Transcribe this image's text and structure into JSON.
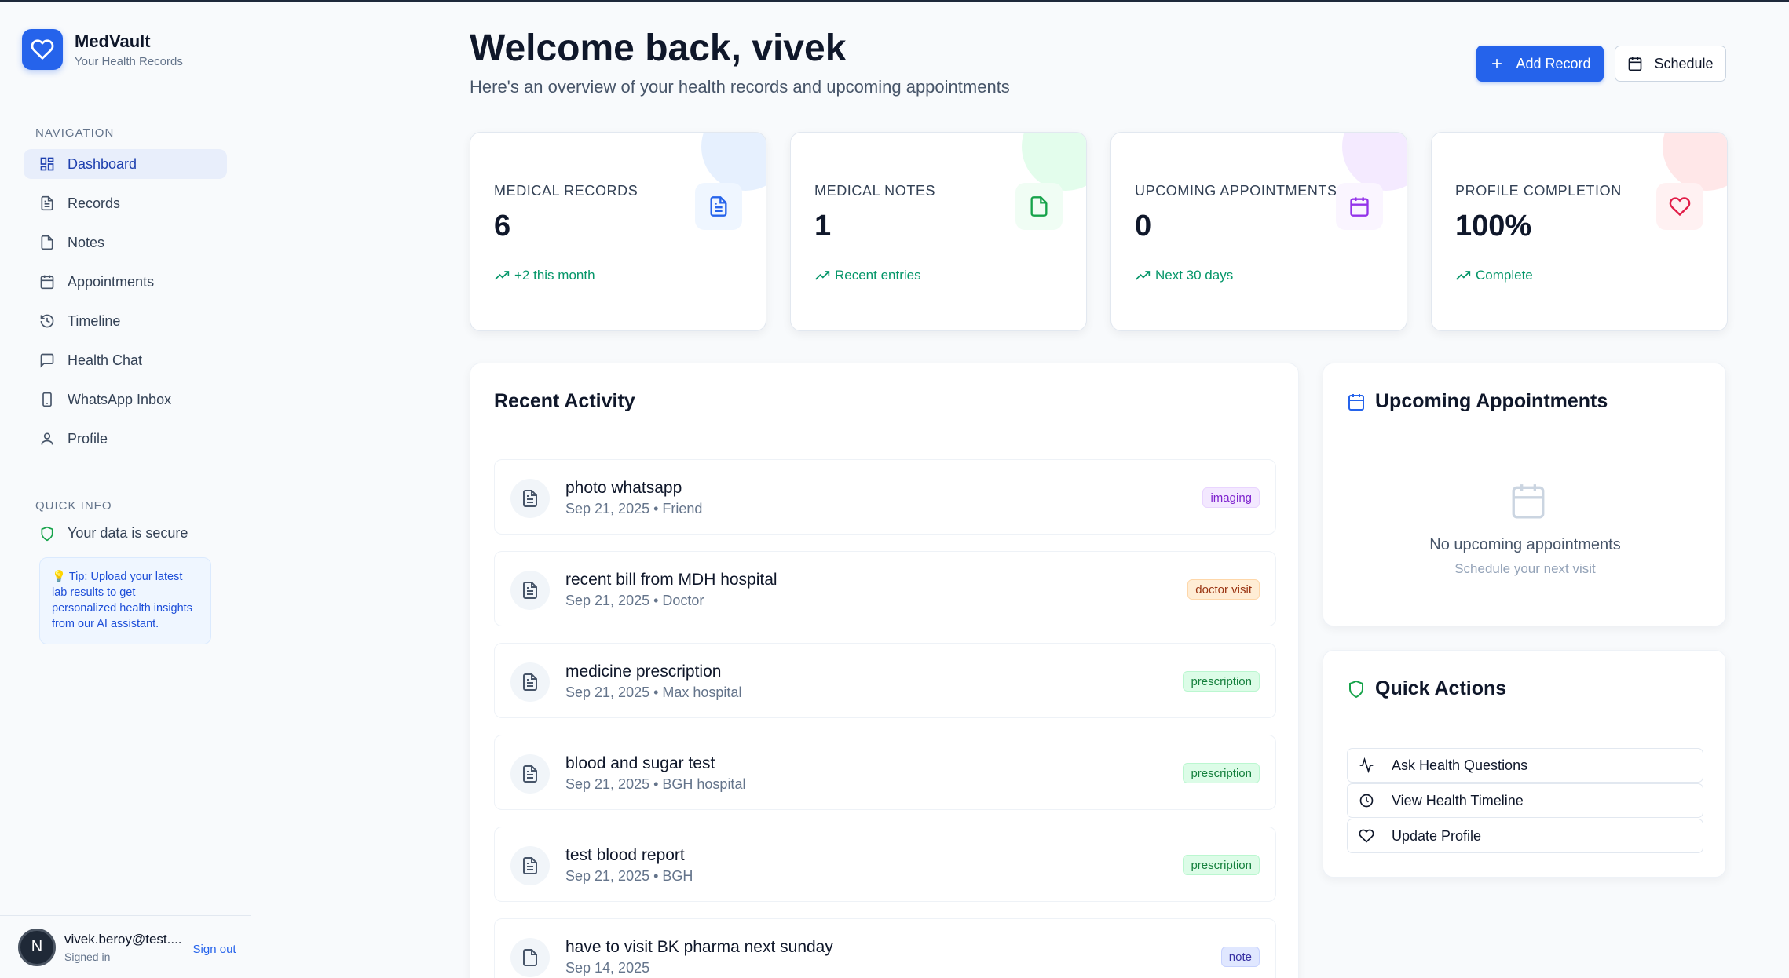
{
  "brand": {
    "name": "MedVault",
    "subtitle": "Your Health Records"
  },
  "sidebar": {
    "nav_title": "NAVIGATION",
    "items": [
      {
        "label": "Dashboard",
        "icon": "dashboard-icon",
        "active": true
      },
      {
        "label": "Records",
        "icon": "file-icon"
      },
      {
        "label": "Notes",
        "icon": "note-icon"
      },
      {
        "label": "Appointments",
        "icon": "calendar-icon"
      },
      {
        "label": "Timeline",
        "icon": "history-icon"
      },
      {
        "label": "Health Chat",
        "icon": "chat-icon"
      },
      {
        "label": "WhatsApp Inbox",
        "icon": "phone-icon"
      },
      {
        "label": "Profile",
        "icon": "user-icon"
      }
    ],
    "quick_title": "QUICK INFO",
    "secure_text": "Your data is secure",
    "tip": "💡 Tip: Upload your latest lab results to get personalized health insights from our AI assistant."
  },
  "user": {
    "initial": "N",
    "email": "vivek.beroy@test....",
    "status": "Signed in",
    "signout": "Sign out"
  },
  "header": {
    "title": "Welcome back, vivek",
    "subtitle": "Here's an overview of your health records and upcoming appointments",
    "add_record": "Add Record",
    "schedule": "Schedule"
  },
  "stats": [
    {
      "label": "MEDICAL RECORDS",
      "value": "6",
      "trend": "+2 this month",
      "color": "#2563eb"
    },
    {
      "label": "MEDICAL NOTES",
      "value": "1",
      "trend": "Recent entries",
      "color": "#16a34a"
    },
    {
      "label": "UPCOMING APPOINTMENTS",
      "value": "0",
      "trend": "Next 30 days",
      "color": "#9333ea"
    },
    {
      "label": "PROFILE COMPLETION",
      "value": "100%",
      "trend": "Complete",
      "color": "#e11d48"
    }
  ],
  "activity": {
    "title": "Recent Activity",
    "items": [
      {
        "title": "photo whatsapp",
        "meta": "Sep 21, 2025 • Friend",
        "badge": "imaging"
      },
      {
        "title": "recent bill from MDH hospital",
        "meta": "Sep 21, 2025 • Doctor",
        "badge": "doctor visit"
      },
      {
        "title": "medicine prescription",
        "meta": "Sep 21, 2025 • Max hospital",
        "badge": "prescription"
      },
      {
        "title": "blood and sugar test",
        "meta": "Sep 21, 2025 • BGH hospital",
        "badge": "prescription"
      },
      {
        "title": "test blood report",
        "meta": "Sep 21, 2025 • BGH",
        "badge": "prescription"
      },
      {
        "title": "have to visit BK pharma next sunday",
        "meta": "Sep 14, 2025",
        "badge": "note"
      }
    ]
  },
  "appointments": {
    "title": "Upcoming Appointments",
    "empty": "No upcoming appointments",
    "empty_sub": "Schedule your next visit"
  },
  "quick_actions": {
    "title": "Quick Actions",
    "items": [
      {
        "label": "Ask Health Questions",
        "icon": "activity-icon"
      },
      {
        "label": "View Health Timeline",
        "icon": "clock-icon"
      },
      {
        "label": "Update Profile",
        "icon": "heart-icon"
      }
    ]
  }
}
